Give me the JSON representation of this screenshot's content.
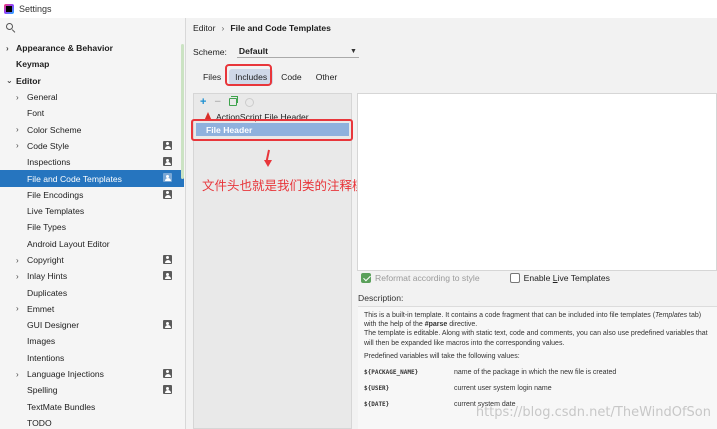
{
  "window": {
    "title": "Settings"
  },
  "tree": {
    "items": [
      {
        "label": "Appearance & Behavior",
        "level": 0,
        "arrow": "›",
        "proj": false,
        "selected": false
      },
      {
        "label": "Keymap",
        "level": 0,
        "arrow": "",
        "proj": false,
        "selected": false
      },
      {
        "label": "Editor",
        "level": 0,
        "arrow": "⌄",
        "proj": false,
        "selected": false
      },
      {
        "label": "General",
        "level": 1,
        "arrow": "›",
        "proj": false,
        "selected": false
      },
      {
        "label": "Font",
        "level": 1,
        "arrow": "",
        "proj": false,
        "selected": false
      },
      {
        "label": "Color Scheme",
        "level": 1,
        "arrow": "›",
        "proj": false,
        "selected": false
      },
      {
        "label": "Code Style",
        "level": 1,
        "arrow": "›",
        "proj": true,
        "selected": false
      },
      {
        "label": "Inspections",
        "level": 1,
        "arrow": "",
        "proj": true,
        "selected": false
      },
      {
        "label": "File and Code Templates",
        "level": 1,
        "arrow": "",
        "proj": true,
        "selected": true
      },
      {
        "label": "File Encodings",
        "level": 1,
        "arrow": "",
        "proj": true,
        "selected": false
      },
      {
        "label": "Live Templates",
        "level": 1,
        "arrow": "",
        "proj": false,
        "selected": false
      },
      {
        "label": "File Types",
        "level": 1,
        "arrow": "",
        "proj": false,
        "selected": false
      },
      {
        "label": "Android Layout Editor",
        "level": 1,
        "arrow": "",
        "proj": false,
        "selected": false
      },
      {
        "label": "Copyright",
        "level": 1,
        "arrow": "›",
        "proj": true,
        "selected": false
      },
      {
        "label": "Inlay Hints",
        "level": 1,
        "arrow": "›",
        "proj": true,
        "selected": false
      },
      {
        "label": "Duplicates",
        "level": 1,
        "arrow": "",
        "proj": false,
        "selected": false
      },
      {
        "label": "Emmet",
        "level": 1,
        "arrow": "›",
        "proj": false,
        "selected": false
      },
      {
        "label": "GUI Designer",
        "level": 1,
        "arrow": "",
        "proj": true,
        "selected": false
      },
      {
        "label": "Images",
        "level": 1,
        "arrow": "",
        "proj": false,
        "selected": false
      },
      {
        "label": "Intentions",
        "level": 1,
        "arrow": "",
        "proj": false,
        "selected": false
      },
      {
        "label": "Language Injections",
        "level": 1,
        "arrow": "›",
        "proj": true,
        "selected": false
      },
      {
        "label": "Spelling",
        "level": 1,
        "arrow": "",
        "proj": true,
        "selected": false
      },
      {
        "label": "TextMate Bundles",
        "level": 1,
        "arrow": "",
        "proj": false,
        "selected": false
      },
      {
        "label": "TODO",
        "level": 1,
        "arrow": "",
        "proj": false,
        "selected": false
      }
    ]
  },
  "breadcrumb": {
    "parent": "Editor",
    "separator": "›",
    "current": "File and Code Templates"
  },
  "scheme": {
    "label": "Scheme:",
    "value": "Default"
  },
  "tabs": {
    "files": "Files",
    "includes": "Includes",
    "code": "Code",
    "other": "Other"
  },
  "list": {
    "toolbar": {
      "add": "+",
      "remove": "−"
    },
    "items": [
      {
        "label": "ActionScript File Header"
      },
      {
        "label": "File Header"
      }
    ]
  },
  "annotation": "文件头也就是我们类的注释模板",
  "options": {
    "reformat": "Reformat according to style",
    "live_templates_pre": "Enable ",
    "live_templates_u": "L",
    "live_templates_post": "ive Templates"
  },
  "description": {
    "label": "Description:",
    "p1_a": "This is a built-in template. It contains a code fragment that can be included into file templates (",
    "p1_b": "Templates",
    "p1_c": " tab) with the help of the ",
    "p1_d": "#parse",
    "p1_e": " directive.",
    "p1_f": "The template is editable. Along with static text, code and comments, you can also use predefined variables that will then be expanded like macros into the corresponding values.",
    "p2": "Predefined variables will take the following values:",
    "vars": [
      {
        "name": "${PACKAGE_NAME}",
        "desc": "name of the package in which the new file is created"
      },
      {
        "name": "${USER}",
        "desc": "current user system login name"
      },
      {
        "name": "${DATE}",
        "desc": "current system date"
      }
    ]
  },
  "watermark": "https://blog.csdn.net/TheWindOfSon"
}
